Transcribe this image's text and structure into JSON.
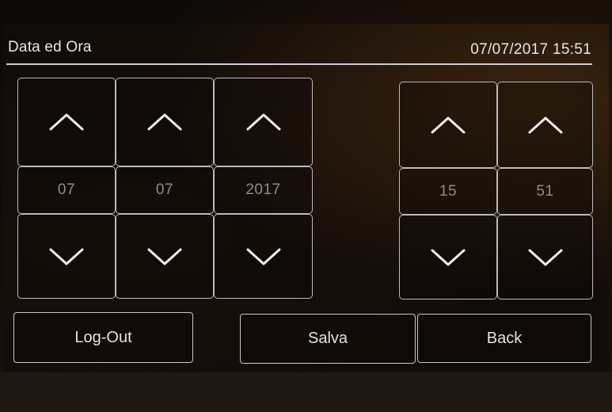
{
  "header": {
    "title": "Data ed Ora",
    "datetime": "07/07/2017 15:51"
  },
  "date": {
    "day": "07",
    "month": "07",
    "year": "2017"
  },
  "time": {
    "hour": "15",
    "minute": "51"
  },
  "buttons": {
    "logout_label": "Log-Out",
    "save_label": "Salva",
    "back_label": "Back"
  },
  "icons": {
    "up": "chevron-up-icon",
    "down": "chevron-down-icon"
  },
  "colors": {
    "background": "#120c09",
    "border": "#bdb9be",
    "text": "#e8e6e8",
    "value_text": "#8f8a8e"
  }
}
